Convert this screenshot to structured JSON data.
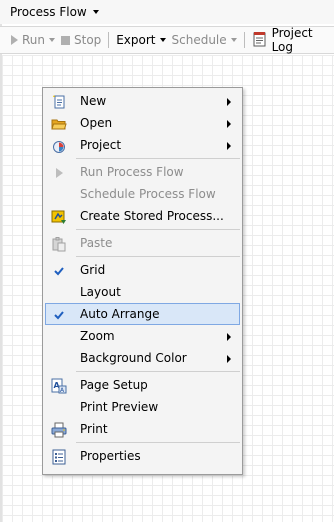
{
  "title_bar": {
    "title": "Process Flow"
  },
  "toolbar": {
    "run": "Run",
    "stop": "Stop",
    "export": "Export",
    "schedule": "Schedule",
    "project_log": "Project Log"
  },
  "menu": {
    "new": "New",
    "open": "Open",
    "project": "Project",
    "run_process_flow": "Run Process Flow",
    "schedule_process_flow": "Schedule Process Flow",
    "create_stored_process": "Create Stored Process...",
    "paste": "Paste",
    "grid": "Grid",
    "layout": "Layout",
    "auto_arrange": "Auto Arrange",
    "zoom": "Zoom",
    "background_color": "Background Color",
    "page_setup": "Page Setup",
    "print_preview": "Print Preview",
    "print": "Print",
    "properties": "Properties"
  },
  "colors": {
    "menu_highlight": "#d9e7f8",
    "menu_highlight_border": "#7fa8e3",
    "check_blue": "#1f5fbf",
    "disabled_text": "#8d8d8d"
  },
  "icons": {
    "title_dropdown": "chevron-down-icon",
    "run": "play-icon",
    "stop": "stop-icon",
    "project_log": "log-icon",
    "new": "new-document-icon",
    "open": "folder-open-icon",
    "project": "project-icon",
    "run_process_flow": "play-icon",
    "create_stored_process": "stored-process-icon",
    "paste": "paste-icon",
    "grid_checked": "checkmark-icon",
    "auto_arrange_checked": "checkmark-icon",
    "page_setup": "page-setup-icon",
    "print": "printer-icon",
    "properties": "properties-icon"
  }
}
